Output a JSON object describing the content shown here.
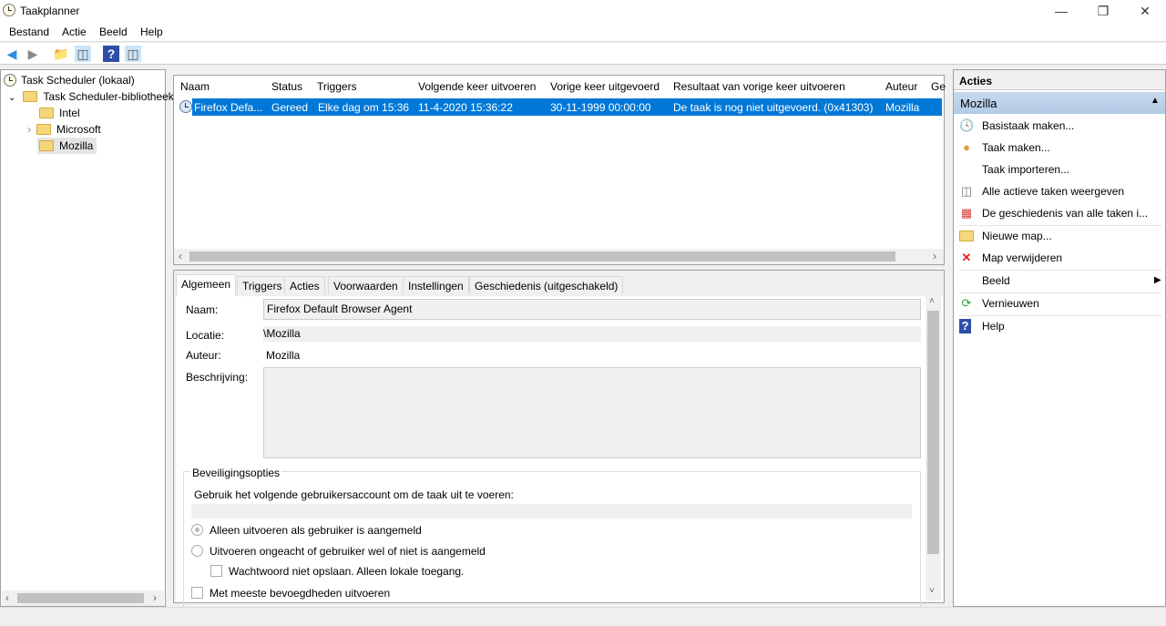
{
  "window": {
    "title": "Taakplanner"
  },
  "menu": [
    "Bestand",
    "Actie",
    "Beeld",
    "Help"
  ],
  "tree": {
    "root": "Task Scheduler (lokaal)",
    "library": "Task Scheduler-bibliotheek",
    "folders": [
      "Intel",
      "Microsoft",
      "Mozilla"
    ]
  },
  "task_list": {
    "columns": [
      "Naam",
      "Status",
      "Triggers",
      "Volgende keer uitvoeren",
      "Vorige keer uitgevoerd",
      "Resultaat van vorige keer uitvoeren",
      "Auteur",
      "Ge"
    ],
    "rows": [
      [
        "Firefox Defa...",
        "Gereed",
        "Elke dag om 15:36",
        "11-4-2020 15:36:22",
        "30-11-1999 00:00:00",
        "De taak is nog niet uitgevoerd. (0x41303)",
        "Mozilla"
      ]
    ]
  },
  "detail": {
    "tabs": [
      "Algemeen",
      "Triggers",
      "Acties",
      "Voorwaarden",
      "Instellingen",
      "Geschiedenis (uitgeschakeld)"
    ],
    "name_label": "Naam:",
    "name_value": "Firefox Default Browser Agent",
    "location_label": "Locatie:",
    "location_value": "\\Mozilla",
    "author_label": "Auteur:",
    "author_value": "Mozilla",
    "description_label": "Beschrijving:",
    "security_title": "Beveiligingsopties",
    "account_label": "Gebruik het volgende gebruikersaccount om de taak uit te voeren:",
    "radio_logged_on": "Alleen uitvoeren als gebruiker is aangemeld",
    "radio_any": "Uitvoeren ongeacht of gebruiker wel of niet is aangemeld",
    "chk_password": "Wachtwoord niet opslaan. Alleen lokale toegang.",
    "chk_highest": "Met meeste bevoegdheden uitvoeren"
  },
  "actions": {
    "header": "Acties",
    "section": "Mozilla",
    "items": [
      "Basistaak maken...",
      "Taak maken...",
      "Taak importeren...",
      "Alle actieve taken weergeven",
      "De geschiedenis van alle taken i...",
      "Nieuwe map...",
      "Map verwijderen",
      "Beeld",
      "Vernieuwen",
      "Help"
    ]
  }
}
